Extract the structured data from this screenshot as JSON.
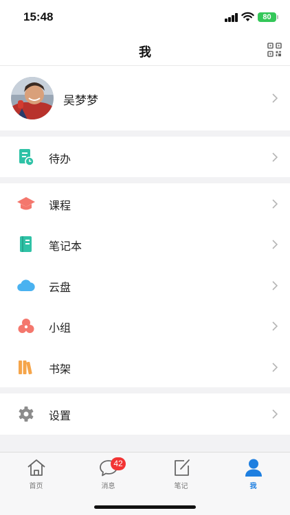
{
  "status_bar": {
    "time": "15:48",
    "battery": "80"
  },
  "header": {
    "title": "我"
  },
  "profile": {
    "name": "吴梦梦"
  },
  "menu_groups": [
    [
      {
        "id": "todo",
        "label": "待办",
        "icon": "todo-icon",
        "color": "#2fc2a6"
      }
    ],
    [
      {
        "id": "courses",
        "label": "课程",
        "icon": "graduation-cap-icon",
        "color": "#f4776d"
      },
      {
        "id": "notebook",
        "label": "笔记本",
        "icon": "notebook-icon",
        "color": "#2fc2a6"
      },
      {
        "id": "cloud",
        "label": "云盘",
        "icon": "cloud-icon",
        "color": "#4ab2f0"
      },
      {
        "id": "groups",
        "label": "小组",
        "icon": "group-icon",
        "color": "#f4776d"
      },
      {
        "id": "bookshelf",
        "label": "书架",
        "icon": "bookshelf-icon",
        "color": "#f5a54a"
      }
    ],
    [
      {
        "id": "settings",
        "label": "设置",
        "icon": "gear-icon",
        "color": "#8c8c8c"
      }
    ]
  ],
  "tabs": [
    {
      "label": "首页",
      "icon": "home-icon"
    },
    {
      "label": "消息",
      "icon": "message-icon",
      "badge": "42"
    },
    {
      "label": "笔记",
      "icon": "note-edit-icon"
    },
    {
      "label": "我",
      "icon": "person-icon",
      "active": true
    }
  ],
  "colors": {
    "accent": "#1e7fe0",
    "badge": "#f23434",
    "teal": "#2fc2a6",
    "coral": "#f4776d",
    "sky": "#4ab2f0",
    "orange": "#f5a54a"
  }
}
